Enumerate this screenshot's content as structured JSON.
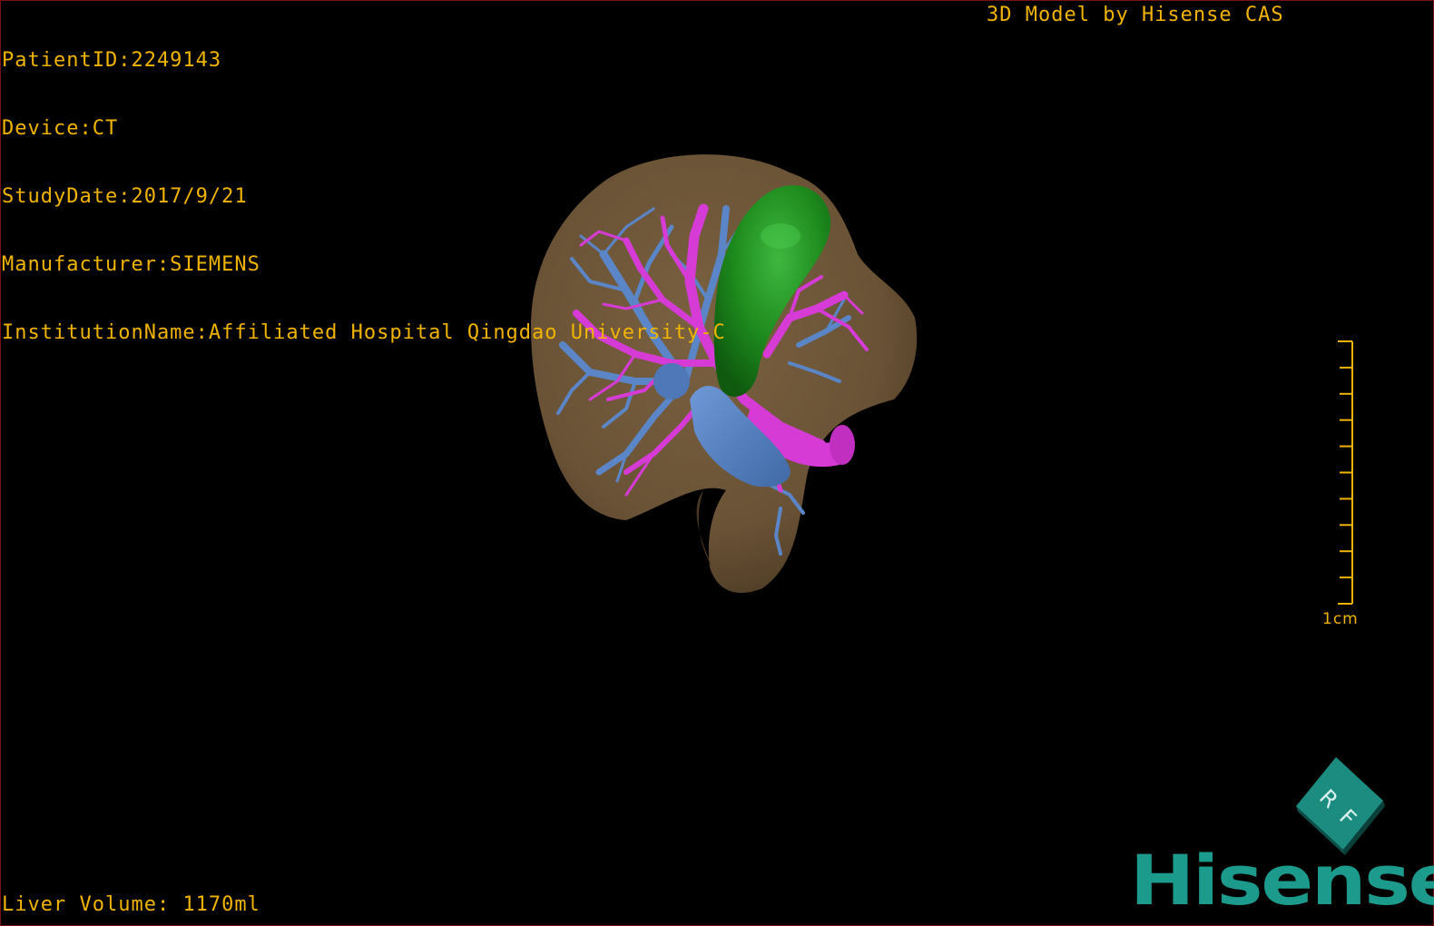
{
  "meta": {
    "patient_id": "PatientID:2249143",
    "device": "Device:CT",
    "study_date": "StudyDate:2017/9/21",
    "manufacturer": "Manufacturer:SIEMENS",
    "institution": "InstitutionName:Affiliated Hospital Qingdao University-C"
  },
  "credit": "3D Model by Hisense CAS",
  "liver_volume": "Liver Volume: 1170ml",
  "scale": {
    "label": "1cm",
    "ticks": 10
  },
  "orientation_cube": {
    "face_letter_1": "R",
    "face_letter_2": "F"
  },
  "logo": "Hisense",
  "colors": {
    "overlay_text": "#f0b400",
    "liver": "#6e5638",
    "gallbladder": "#1f8c1f",
    "portal_vein": "#d63bd6",
    "hepatic_vein": "#5a86c8",
    "brand": "#1c9a8c"
  }
}
